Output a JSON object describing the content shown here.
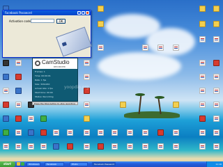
{
  "activation_window": {
    "title": "Facebook Password",
    "field_label": "Activation code :",
    "field_value": "",
    "ok_label": "OK"
  },
  "camstudio": {
    "logo": "CamStudio",
    "tagline": "RECORDER",
    "stats": [
      "Frames: 1",
      "Time: 00:00:01",
      "Rate: 1 fps",
      "Size: 320x240",
      "Actual rate: 1 fps",
      "Start time: 00:00",
      "Status: Recording"
    ],
    "status_bar": "Press the Stop button to stop recording"
  },
  "watermark": "yoopdio.org",
  "taskbar": {
    "start_label": "start",
    "tasks": [
      "Windows Live",
      "Facebook",
      "Photo",
      "Facebook Password"
    ],
    "clock": "11:16"
  },
  "colors": {
    "accent": "#0a5ee0",
    "start": "#3a9a32",
    "cam_panel": "#0f5a73"
  }
}
